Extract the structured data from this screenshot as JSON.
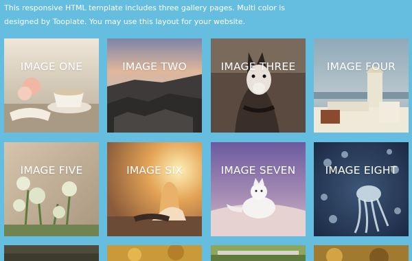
{
  "intro": {
    "text": "This responsive HTML template includes three gallery pages. Multi color is designed by Tooplate. You may use this layout for your website."
  },
  "gallery": {
    "items": [
      {
        "label": "IMAGE ONE",
        "subject": "teacup-flowers-photo"
      },
      {
        "label": "IMAGE TWO",
        "subject": "rocky-coast-sunset-photo"
      },
      {
        "label": "IMAGE THREE",
        "subject": "husky-dog-photo"
      },
      {
        "label": "IMAGE FOUR",
        "subject": "white-villa-sea-photo"
      },
      {
        "label": "IMAGE FIVE",
        "subject": "white-wildflowers-photo"
      },
      {
        "label": "IMAGE SIX",
        "subject": "girl-sunset-photo"
      },
      {
        "label": "IMAGE SEVEN",
        "subject": "arctic-fox-photo"
      },
      {
        "label": "IMAGE EIGHT",
        "subject": "jellyfish-photo"
      }
    ]
  },
  "colors": {
    "background": "#65bddf",
    "text": "#ffffff"
  }
}
